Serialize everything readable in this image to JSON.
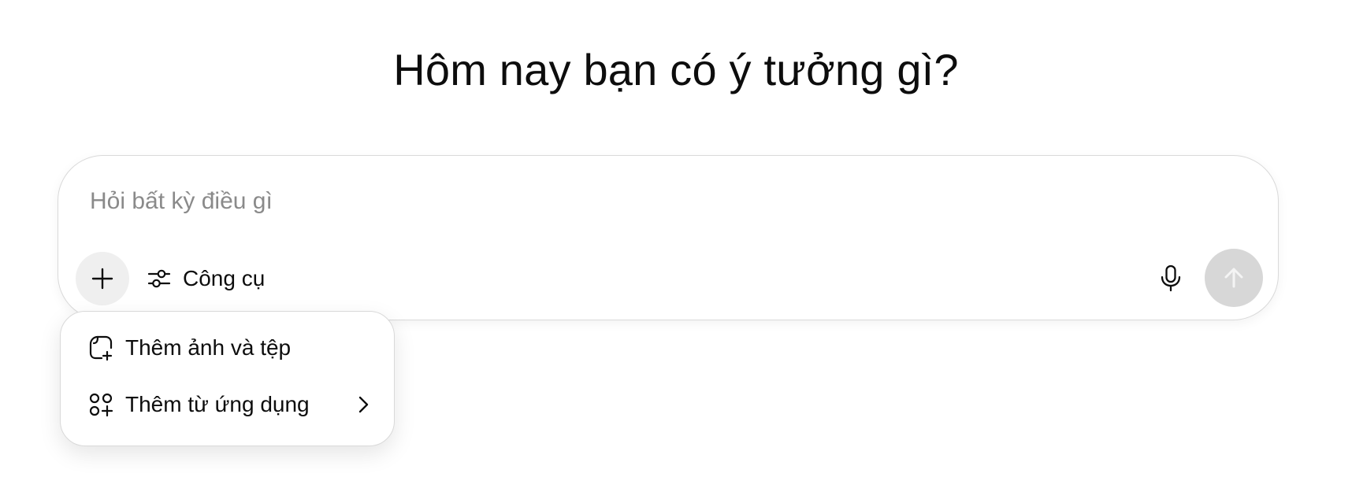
{
  "header": {
    "title": "Hôm nay bạn có ý tưởng gì?"
  },
  "composer": {
    "placeholder": "Hỏi bất kỳ điều gì",
    "value": "",
    "tools_label": "Công cụ",
    "icons": {
      "plus": "plus-icon",
      "tools": "sliders-icon",
      "mic": "microphone-icon",
      "send": "arrow-up-icon"
    },
    "send_disabled": true
  },
  "menu": {
    "items": [
      {
        "label": "Thêm ảnh và tệp",
        "icon": "attach-file-icon"
      },
      {
        "label": "Thêm từ ứng dụng",
        "icon": "apps-icon",
        "has_submenu": true
      }
    ]
  },
  "colors": {
    "send_disabled_bg": "#d7d7d7",
    "plus_bg": "#efefef",
    "border": "#d9d9d9",
    "placeholder": "#8a8a8a"
  }
}
